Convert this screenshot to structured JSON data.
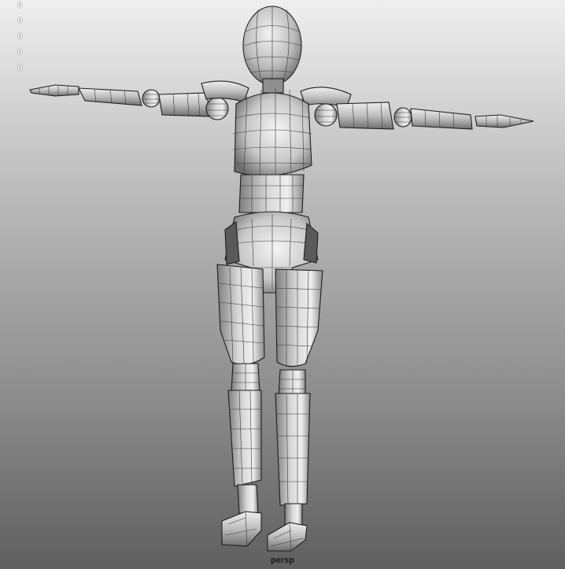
{
  "viewport": {
    "camera_label": "persp",
    "hud_values": [
      "0",
      "0",
      "0",
      "0",
      "0"
    ],
    "scene_object": "mannequin-model"
  }
}
